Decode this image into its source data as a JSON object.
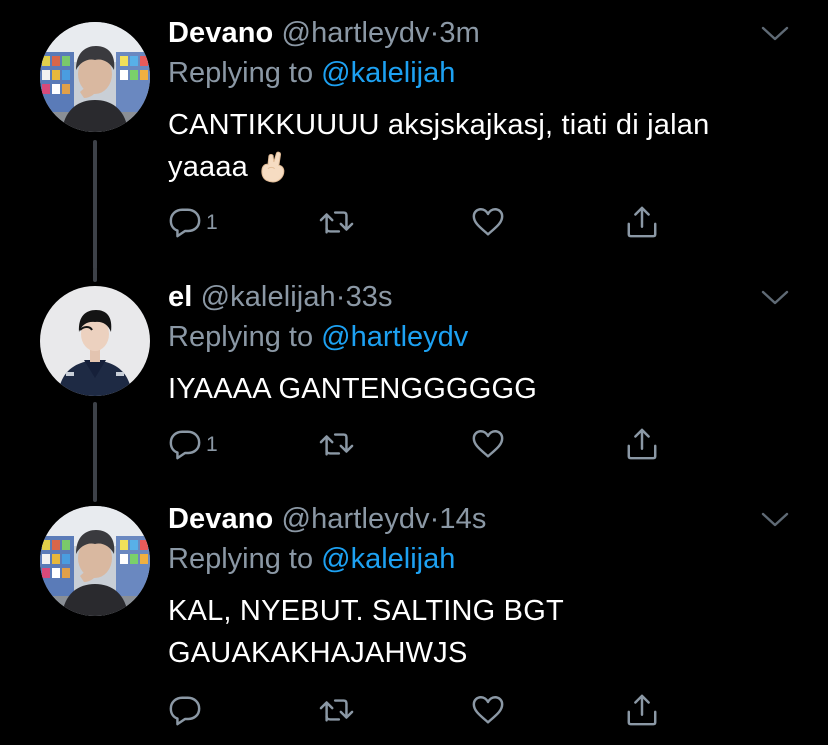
{
  "colors": {
    "background": "#000000",
    "text_primary": "#ffffff",
    "text_secondary": "#8b98a5",
    "mention": "#1da1f2",
    "thread_line": "#3d4148"
  },
  "tweets": [
    {
      "display_name": "Devano",
      "handle": "@hartleydv",
      "separator": "·",
      "time": "3m",
      "replying_prefix": "Replying to",
      "replying_to": "@kalelijah",
      "text": "CANTIKKUUUU aksjskajkasj, tiati di jalan yaaaa",
      "emoji_icon": "crossed-fingers-icon",
      "reply_count": "1",
      "avatar_icon": "avatar-devano"
    },
    {
      "display_name": "el",
      "handle": "@kalelijah",
      "separator": "·",
      "time": "33s",
      "replying_prefix": "Replying to",
      "replying_to": "@hartleydv",
      "text": "IYAAAA GANTENGGGGGG",
      "reply_count": "1",
      "avatar_icon": "avatar-el"
    },
    {
      "display_name": "Devano",
      "handle": "@hartleydv",
      "separator": "·",
      "time": "14s",
      "replying_prefix": "Replying to",
      "replying_to": "@kalelijah",
      "text": "KAL, NYEBUT. SALTING BGT GAUAKAKHAJAHWJS",
      "reply_count": "",
      "avatar_icon": "avatar-devano"
    }
  ],
  "icons": {
    "reply": "reply-icon",
    "retweet": "retweet-icon",
    "like": "heart-icon",
    "share": "share-icon",
    "more": "chevron-down-icon"
  }
}
